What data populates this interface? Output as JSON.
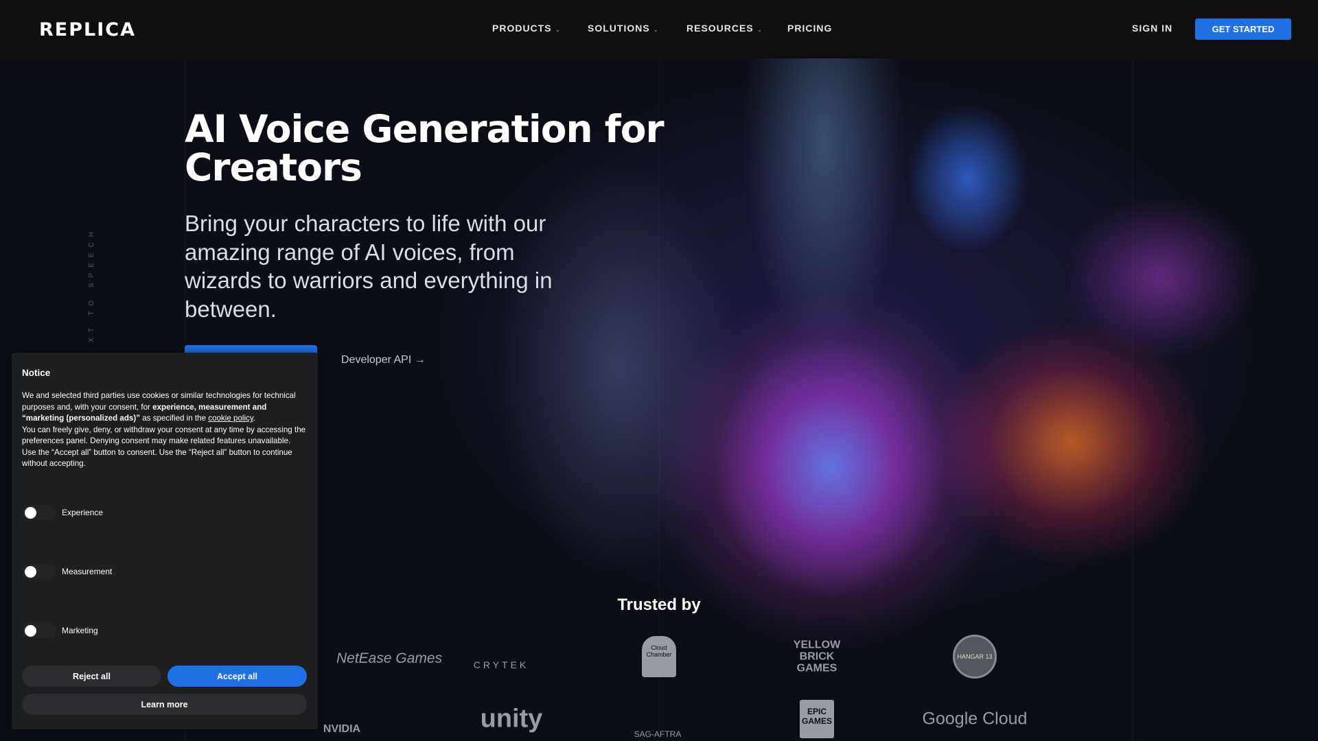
{
  "nav": {
    "logo": "REPLICA",
    "items": [
      {
        "label": "PRODUCTS",
        "dropdown": true
      },
      {
        "label": "SOLUTIONS",
        "dropdown": true
      },
      {
        "label": "RESOURCES",
        "dropdown": true
      },
      {
        "label": "PRICING",
        "dropdown": false
      }
    ],
    "sign_in": "SIGN IN",
    "get_started": "GET STARTED",
    "chevron_icon": "chevron-down-icon"
  },
  "hero": {
    "side_label": "XT TO SPEECH",
    "title": "AI Voice Generation for Creators",
    "subtitle": "Bring your characters to life with our amazing range of AI voices, from wizards to warriors and everything in between.",
    "developer_api": "Developer API →"
  },
  "trusted": {
    "heading": "Trusted by",
    "logos": [
      "NetEase Games",
      "CRYTEK",
      "Cloud Chamber",
      "YELLOW BRICK GAMES",
      "HANGAR 13",
      "NVIDIA",
      "unity",
      "SAG-AFTRA",
      "EPIC GAMES",
      "Google Cloud"
    ]
  },
  "cookie": {
    "title": "Notice",
    "p1a": "We and selected third parties use cookies or similar technologies for technical purposes and, with your consent, for ",
    "p1b": "experience, measurement and “marketing (personalized ads)”",
    "p1c": " as specified in the ",
    "link": "cookie policy",
    "p1d": ".",
    "p2": "You can freely give, deny, or withdraw your consent at any time by accessing the preferences panel. Denying consent may make related features unavailable.",
    "p3": "Use the “Accept all” button to consent. Use the “Reject all” button to continue without accepting.",
    "toggles": [
      {
        "label": "Experience",
        "on": false
      },
      {
        "label": "Measurement",
        "on": false
      },
      {
        "label": "Marketing",
        "on": false
      }
    ],
    "reject": "Reject all",
    "accept": "Accept all",
    "learn_more": "Learn more"
  },
  "colors": {
    "accent": "#1f6fe5",
    "nav_bg": "#0f0f10",
    "page_bg": "#0b0e17",
    "cookie_bg": "#1e1f21"
  }
}
